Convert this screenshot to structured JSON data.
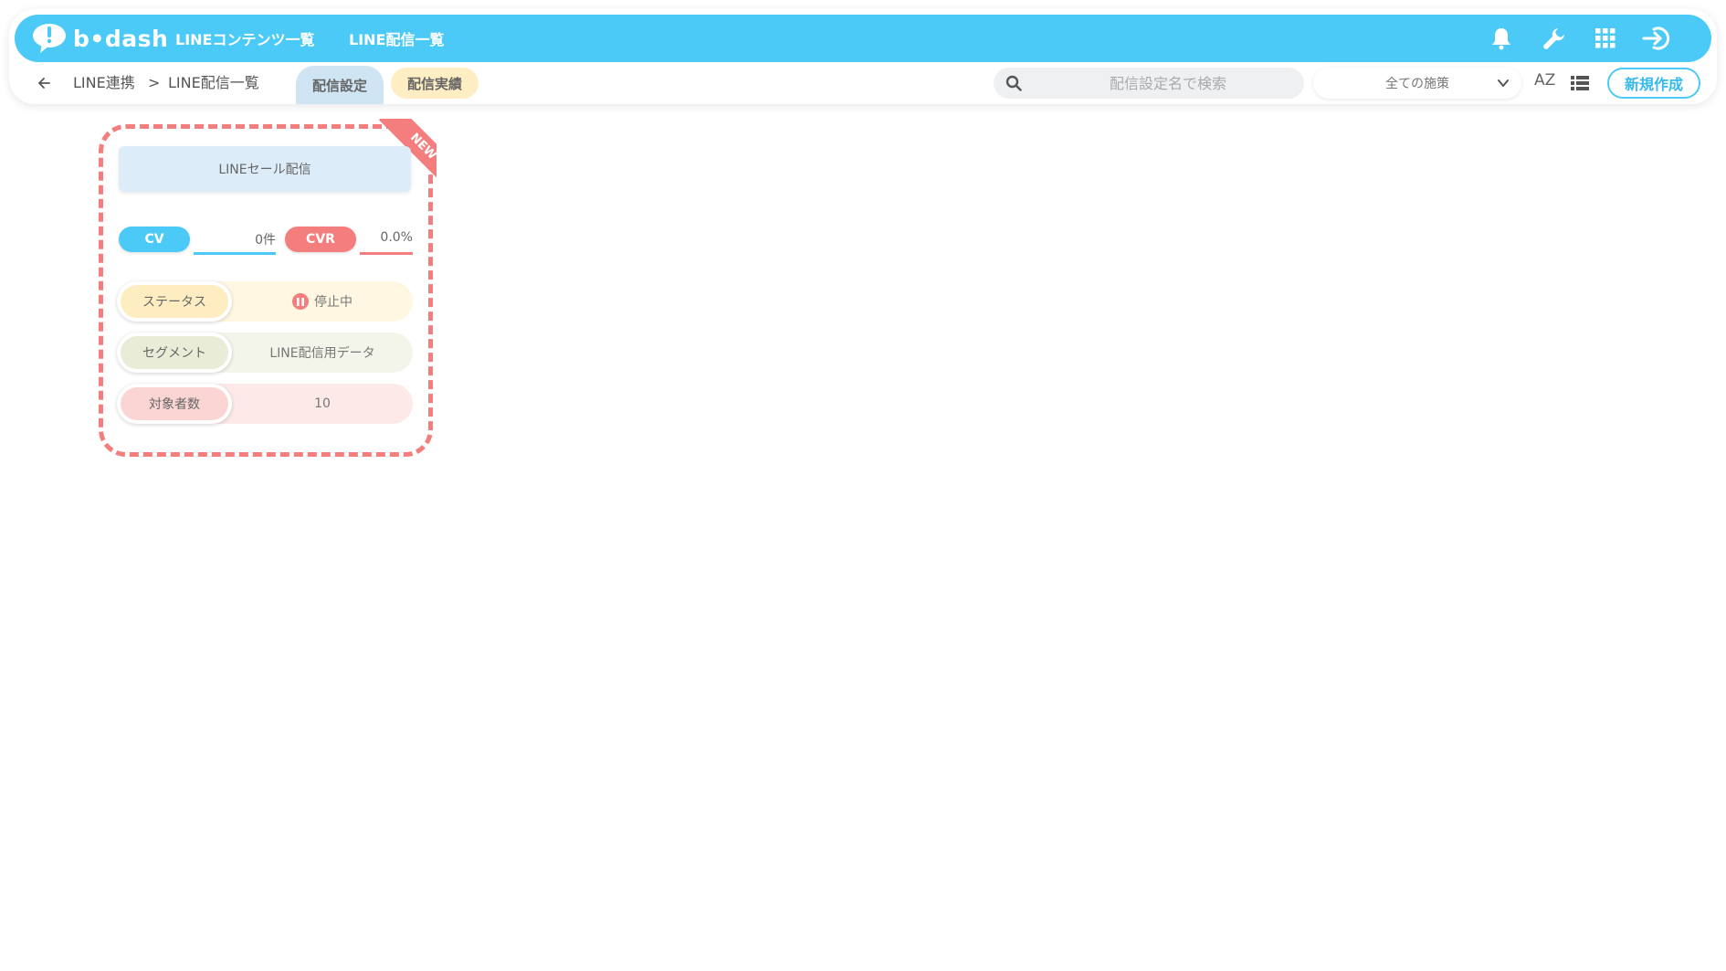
{
  "brand": {
    "name": "b•dash",
    "accent": "#4ccaf7",
    "danger": "#f47d7d"
  },
  "topnav": {
    "contents_label": "LINEコンテンツ一覧",
    "delivery_label": "LINE配信一覧"
  },
  "topbar_icons": [
    "bell-icon",
    "wrench-icon",
    "grid-icon",
    "logout-icon"
  ],
  "breadcrumb": {
    "parent": "LINE連携",
    "separator": ">",
    "current": "LINE配信一覧"
  },
  "tabs": [
    {
      "label": "配信設定",
      "active": true
    },
    {
      "label": "配信実績",
      "active": false
    }
  ],
  "search": {
    "placeholder": "配信設定名で検索",
    "value": ""
  },
  "filter": {
    "selected": "全ての施策"
  },
  "sort_label": "AZ",
  "new_button": "新規作成",
  "card": {
    "badge": "NEW",
    "title": "LINEセール配信",
    "cv_label": "CV",
    "cv_value": "0件",
    "cvr_label": "CVR",
    "cvr_value": "0.0%",
    "rows": [
      {
        "label": "ステータス",
        "value": "停止中"
      },
      {
        "label": "セグメント",
        "value": "LINE配信用データ"
      },
      {
        "label": "対象者数",
        "value": "10"
      }
    ]
  }
}
